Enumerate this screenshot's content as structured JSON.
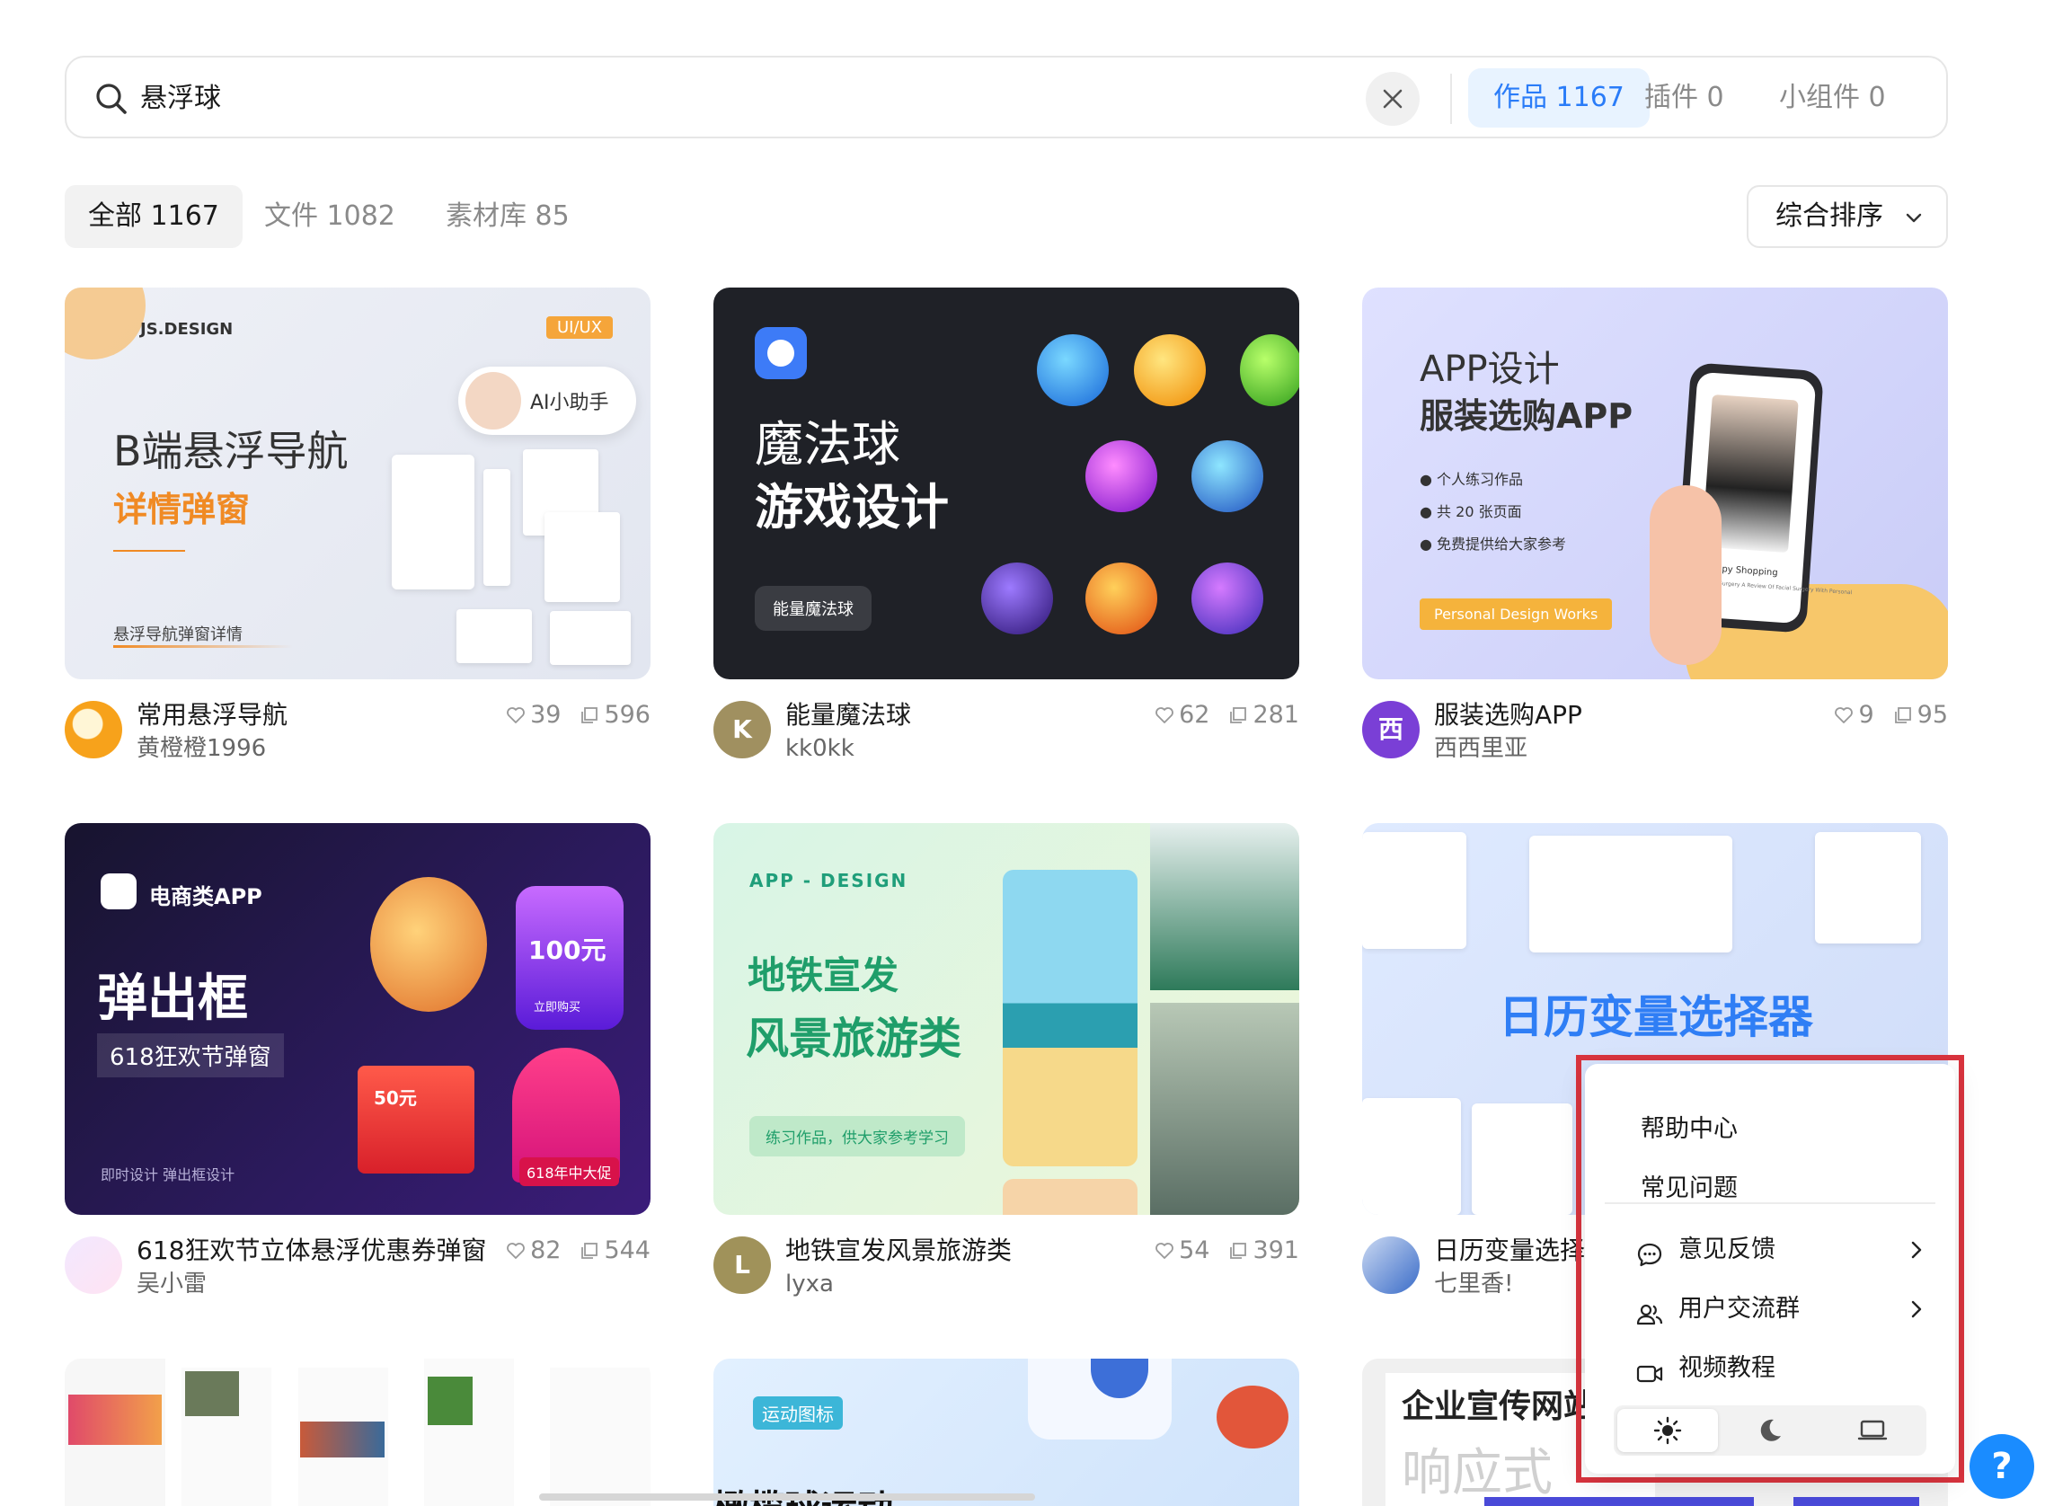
{
  "search": {
    "query": "悬浮球",
    "scopes": [
      {
        "label": "作品 1167"
      },
      {
        "label": "插件 0"
      },
      {
        "label": "小组件 0"
      }
    ]
  },
  "filters": {
    "tabs": [
      {
        "label": "全部 1167"
      },
      {
        "label": "文件 1082"
      },
      {
        "label": "素材库 85"
      }
    ],
    "sort_label": "综合排序"
  },
  "cards": [
    {
      "title": "常用悬浮导航",
      "author": "黄橙橙1996",
      "likes": "39",
      "copies": "596",
      "thumb": {
        "brand": "JS.DESIGN",
        "tag": "UI/UX",
        "ai_pill": "AI小助手",
        "heading": "B端悬浮导航",
        "subheading": "详情弹窗",
        "caption": "悬浮导航弹窗详情"
      }
    },
    {
      "title": "能量魔法球",
      "author": "kk0kk",
      "likes": "62",
      "copies": "281",
      "avatar_letter": "K",
      "thumb": {
        "heading": "魔法球",
        "subheading": "游戏设计",
        "button": "能量魔法球"
      }
    },
    {
      "title": "服装选购APP",
      "author": "西西里亚",
      "likes": "9",
      "copies": "95",
      "avatar_letter": "西",
      "thumb": {
        "heading": "APP设计",
        "subheading": "服装选购APP",
        "bullets": [
          "个人练习作品",
          "共 20 张页面",
          "免费提供给大家参考"
        ],
        "badge": "Personal Design Works",
        "phone_title": "Happy Shopping",
        "phone_caption": "Cosmetic Surgery A Review Of Facial Surgery With Personal"
      }
    },
    {
      "title": "618狂欢节立体悬浮优惠券弹窗",
      "author": "吴小雷",
      "likes": "82",
      "copies": "544",
      "thumb": {
        "brand": "电商类APP",
        "heading": "弹出框",
        "subheading": "618狂欢节弹窗",
        "caption": "即时设计 弹出框设计",
        "coupon_value": "100元",
        "coupon_btn": "立即购买",
        "box_price": "50元",
        "banner": "618年中大促"
      }
    },
    {
      "title": "地铁宣发风景旅游类",
      "author": "lyxa",
      "likes": "54",
      "copies": "391",
      "avatar_letter": "L",
      "thumb": {
        "brand": "APP - DESIGN",
        "heading": "地铁宣发",
        "subheading": "风景旅游类",
        "button": "练习作品，供大家参考学习"
      }
    },
    {
      "title": "日历变量选择器",
      "author": "七里香!",
      "likes": "",
      "copies": "",
      "thumb": {
        "heading": "日历变量选择器"
      }
    },
    {
      "thumb": {
        "heading": ""
      }
    },
    {
      "thumb": {
        "tag": "运动图标",
        "heading": "橄榄球运动"
      }
    },
    {
      "thumb": {
        "heading": "企业宣传网站",
        "subheading": "响应式"
      }
    }
  ],
  "menu": {
    "items": [
      {
        "label": "帮助中心"
      },
      {
        "label": "常见问题"
      },
      {
        "label": "意见反馈",
        "icon": "chat-bubble-icon"
      },
      {
        "label": "用户交流群",
        "icon": "users-icon"
      },
      {
        "label": "视频教程",
        "icon": "video-camera-icon"
      }
    ],
    "themes": [
      "sun-icon",
      "moon-icon",
      "monitor-icon"
    ],
    "active_theme": "light"
  },
  "help_fab": "?",
  "colors": {
    "accent": "#2a7cf8",
    "highlight": "#d9343e"
  }
}
